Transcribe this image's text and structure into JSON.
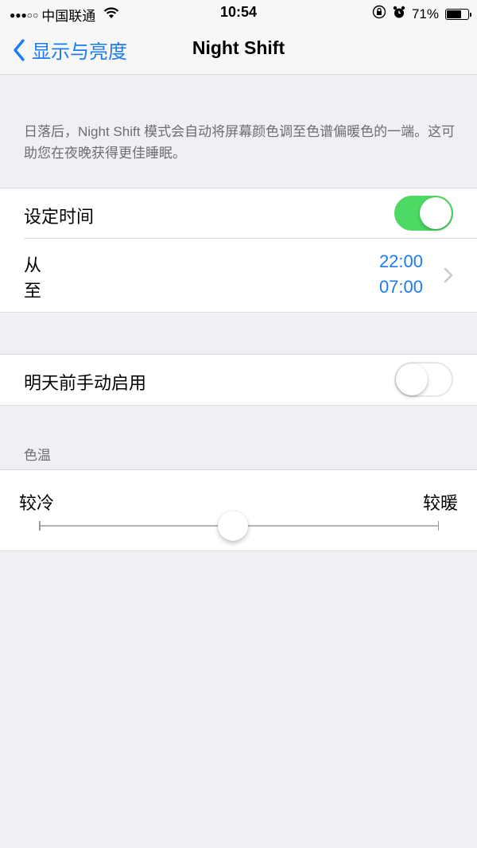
{
  "status_bar": {
    "signal": "●●●○○",
    "carrier": "中国联通",
    "wifi_icon": "wifi-icon",
    "time": "10:54",
    "orientation_lock_icon": "orientation-lock-icon",
    "alarm_icon": "alarm-icon",
    "battery_percent": "71%",
    "battery_level": 0.71
  },
  "nav": {
    "back_label": "显示与亮度",
    "title": "Night Shift"
  },
  "description": "日落后，Night Shift 模式会自动将屏幕颜色调至色谱偏暖色的一端。这可助您在夜晚获得更佳睡眠。",
  "schedule": {
    "label": "设定时间",
    "enabled": true,
    "from_label": "从",
    "to_label": "至",
    "from_time": "22:00",
    "to_time": "07:00"
  },
  "manual": {
    "label": "明天前手动启用",
    "enabled": false
  },
  "color_temperature": {
    "header": "色温",
    "min_label": "较冷",
    "max_label": "较暖",
    "value": 0.485
  }
}
